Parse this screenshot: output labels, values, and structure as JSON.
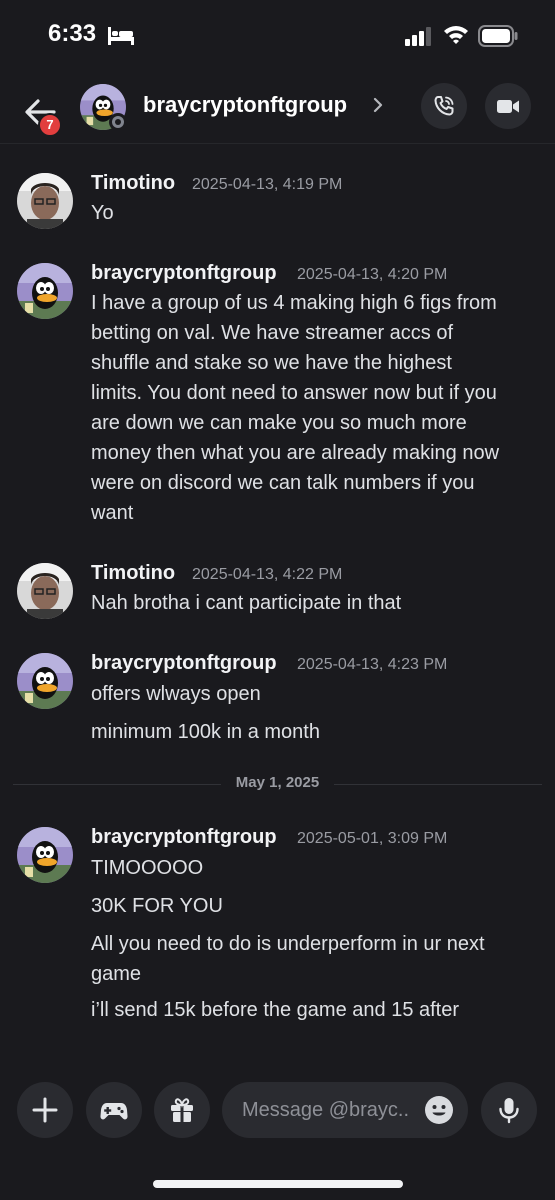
{
  "status_bar": {
    "time": "6:33"
  },
  "header": {
    "badge_count": "7",
    "title": "braycryptonftgroup",
    "chevron": "›"
  },
  "messages": [
    {
      "author": "Timotino",
      "timestamp": "2025-04-13, 4:19 PM",
      "lines": [
        "Yo"
      ]
    },
    {
      "author": "braycryptonftgroup",
      "timestamp": "2025-04-13, 4:20 PM",
      "lines": [
        "I have a group of us 4 making high 6 figs from",
        "betting on val. We have streamer accs of",
        "shuffle and stake so we have the highest",
        "limits. You dont need to answer now but if you",
        "are down we can make you so much more",
        "money then what you are already making now",
        "were on discord we can talk numbers if you",
        "want"
      ]
    },
    {
      "author": "Timotino",
      "timestamp": "2025-04-13, 4:22 PM",
      "lines": [
        "Nah brotha i cant participate in that"
      ]
    },
    {
      "author": "braycryptonftgroup",
      "timestamp": "2025-04-13, 4:23 PM",
      "lines": [
        "offers wlways open",
        "minimum 100k in a month"
      ]
    },
    {
      "author": "braycryptonftgroup",
      "timestamp": "2025-05-01, 3:09 PM",
      "lines": [
        "TIMOOOOO",
        "30K FOR YOU",
        "All you need to do is underperform in ur next",
        "game",
        "i’ll send 15k before the game and 15 after"
      ]
    }
  ],
  "date_divider": "May 1, 2025",
  "composer": {
    "placeholder": "Message @brayc.."
  },
  "colors": {
    "background": "#1a1a1e",
    "badge": "#e23e3e",
    "button": "#2a2b30"
  },
  "icons": [
    "bed-icon",
    "signal-icon",
    "wifi-icon",
    "battery-icon",
    "back-arrow-icon",
    "call-icon",
    "video-icon",
    "plus-icon",
    "gamepad-icon",
    "gift-icon",
    "emoji-icon",
    "microphone-icon"
  ]
}
